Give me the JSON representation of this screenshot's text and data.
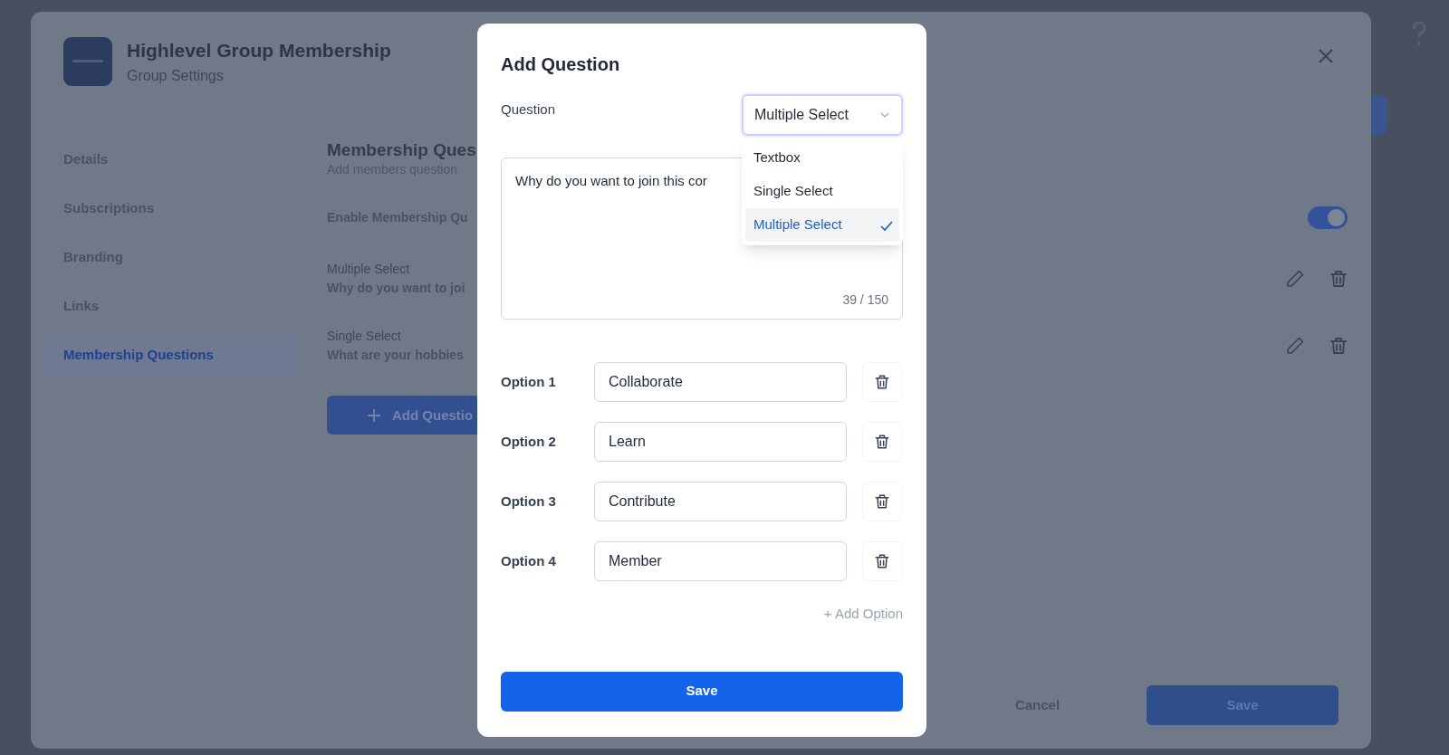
{
  "settings_modal": {
    "title": "Highlevel Group Membership",
    "subtitle": "Group Settings",
    "sidebar": {
      "items": [
        {
          "label": "Details",
          "selected": false
        },
        {
          "label": "Subscriptions",
          "selected": false
        },
        {
          "label": "Branding",
          "selected": false
        },
        {
          "label": "Links",
          "selected": false
        },
        {
          "label": "Membership Questions",
          "selected": true
        }
      ]
    },
    "section": {
      "title": "Membership Ques",
      "subtitle": "Add members question",
      "toggle_label": "Enable Membership Qu",
      "toggle_on": true,
      "questions": [
        {
          "type": "Multiple Select",
          "text": "Why do you want to joi"
        },
        {
          "type": "Single Select",
          "text": "What are your hobbies"
        }
      ],
      "add_button": "Add Questio"
    },
    "footer": {
      "cancel": "Cancel",
      "save": "Save"
    }
  },
  "dialog": {
    "title": "Add Question",
    "question_label": "Question",
    "type_select": {
      "value": "Multiple Select",
      "expanded": true
    },
    "type_options": [
      {
        "label": "Textbox",
        "selected": false
      },
      {
        "label": "Single Select",
        "selected": false
      },
      {
        "label": "Multiple Select",
        "selected": true
      }
    ],
    "question_text": "Why do you want to join this cor",
    "char_count": "39 / 150",
    "options": [
      {
        "label": "Option 1",
        "value": "Collaborate"
      },
      {
        "label": "Option 2",
        "value": "Learn"
      },
      {
        "label": "Option 3",
        "value": "Contribute"
      },
      {
        "label": "Option 4",
        "value": "Member"
      }
    ],
    "add_option": "+ Add Option",
    "save": "Save"
  }
}
